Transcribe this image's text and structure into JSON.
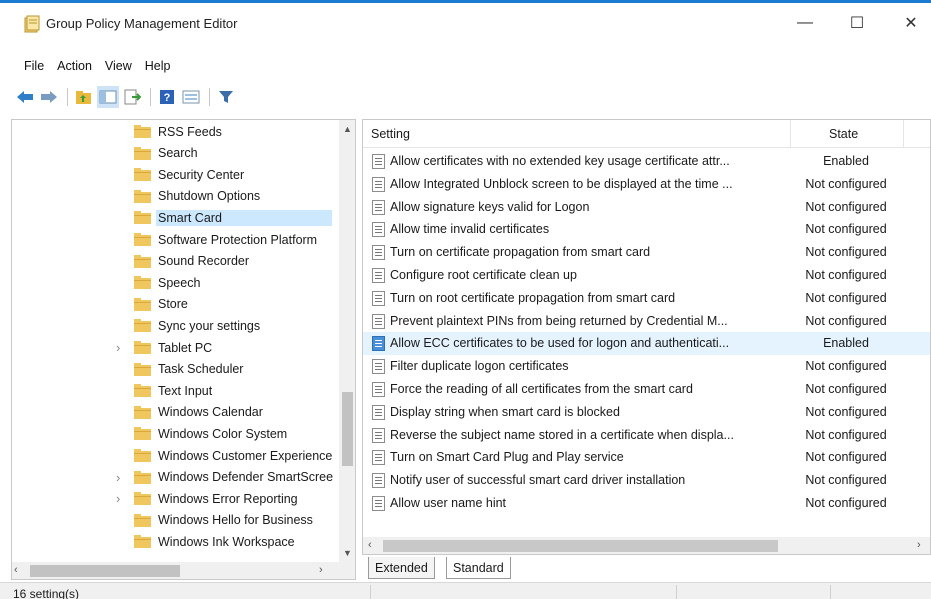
{
  "window": {
    "title": "Group Policy Management Editor",
    "minimize": "—",
    "maximize": "☐",
    "close": "✕"
  },
  "menu": [
    "File",
    "Action",
    "View",
    "Help"
  ],
  "toolbar": {
    "icons": [
      "back-arrow-icon",
      "forward-arrow-icon",
      "up-folder-icon",
      "show-hide-tree-icon",
      "export-list-icon",
      "help-icon",
      "properties-icon",
      "filter-icon"
    ]
  },
  "tree": {
    "items": [
      {
        "label": "RSS Feeds",
        "expandable": false,
        "selected": false
      },
      {
        "label": "Search",
        "expandable": false,
        "selected": false
      },
      {
        "label": "Security Center",
        "expandable": false,
        "selected": false
      },
      {
        "label": "Shutdown Options",
        "expandable": false,
        "selected": false
      },
      {
        "label": "Smart Card",
        "expandable": false,
        "selected": true
      },
      {
        "label": "Software Protection Platform",
        "expandable": false,
        "selected": false
      },
      {
        "label": "Sound Recorder",
        "expandable": false,
        "selected": false
      },
      {
        "label": "Speech",
        "expandable": false,
        "selected": false
      },
      {
        "label": "Store",
        "expandable": false,
        "selected": false
      },
      {
        "label": "Sync your settings",
        "expandable": false,
        "selected": false
      },
      {
        "label": "Tablet PC",
        "expandable": true,
        "selected": false
      },
      {
        "label": "Task Scheduler",
        "expandable": false,
        "selected": false
      },
      {
        "label": "Text Input",
        "expandable": false,
        "selected": false
      },
      {
        "label": "Windows Calendar",
        "expandable": false,
        "selected": false
      },
      {
        "label": "Windows Color System",
        "expandable": false,
        "selected": false
      },
      {
        "label": "Windows Customer Experience",
        "expandable": false,
        "selected": false
      },
      {
        "label": "Windows Defender SmartScreen",
        "expandable": true,
        "selected": false
      },
      {
        "label": "Windows Error Reporting",
        "expandable": true,
        "selected": false
      },
      {
        "label": "Windows Hello for Business",
        "expandable": false,
        "selected": false
      },
      {
        "label": "Windows Ink Workspace",
        "expandable": false,
        "selected": false
      }
    ]
  },
  "list": {
    "columns": {
      "setting": "Setting",
      "state": "State"
    },
    "rows": [
      {
        "setting": "Allow certificates with no extended key usage certificate attr...",
        "state": "Enabled",
        "highlight": false
      },
      {
        "setting": "Allow Integrated Unblock screen to be displayed at the time ...",
        "state": "Not configured",
        "highlight": false
      },
      {
        "setting": "Allow signature keys valid for Logon",
        "state": "Not configured",
        "highlight": false
      },
      {
        "setting": "Allow time invalid certificates",
        "state": "Not configured",
        "highlight": false
      },
      {
        "setting": "Turn on certificate propagation from smart card",
        "state": "Not configured",
        "highlight": false
      },
      {
        "setting": "Configure root certificate clean up",
        "state": "Not configured",
        "highlight": false
      },
      {
        "setting": "Turn on root certificate propagation from smart card",
        "state": "Not configured",
        "highlight": false
      },
      {
        "setting": "Prevent plaintext PINs from being returned by Credential M...",
        "state": "Not configured",
        "highlight": false
      },
      {
        "setting": "Allow ECC certificates to be used for logon and authenticati...",
        "state": "Enabled",
        "highlight": true
      },
      {
        "setting": "Filter duplicate logon certificates",
        "state": "Not configured",
        "highlight": false
      },
      {
        "setting": "Force the reading of all certificates from the smart card",
        "state": "Not configured",
        "highlight": false
      },
      {
        "setting": "Display string when smart card is blocked",
        "state": "Not configured",
        "highlight": false
      },
      {
        "setting": "Reverse the subject name stored in a certificate when displa...",
        "state": "Not configured",
        "highlight": false
      },
      {
        "setting": "Turn on Smart Card Plug and Play service",
        "state": "Not configured",
        "highlight": false
      },
      {
        "setting": "Notify user of successful smart card driver installation",
        "state": "Not configured",
        "highlight": false
      },
      {
        "setting": "Allow user name hint",
        "state": "Not configured",
        "highlight": false
      }
    ]
  },
  "tabs": {
    "extended": "Extended",
    "standard": "Standard"
  },
  "status": {
    "text": "16 setting(s)"
  },
  "colors": {
    "accent": "#1a7bd1",
    "selection": "#cce8ff",
    "row_highlight": "#e5f3ff",
    "folder": "#f0c75e"
  }
}
